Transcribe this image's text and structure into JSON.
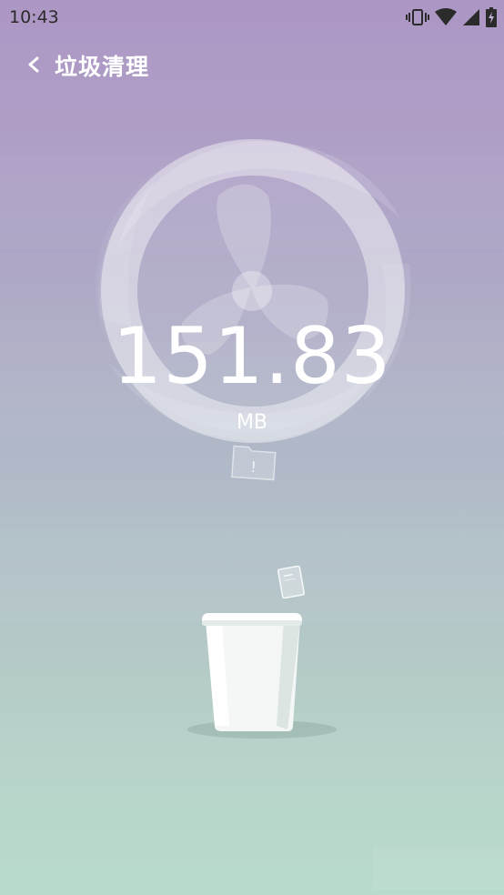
{
  "status_bar": {
    "time": "10:43",
    "icons": [
      "vibrate-icon",
      "wifi-icon",
      "signal-icon",
      "battery-icon"
    ]
  },
  "header": {
    "back_icon": "chevron-left-icon",
    "title": "垃圾清理"
  },
  "scan": {
    "size_value": "151.83",
    "size_unit": "MB"
  },
  "decor": {
    "fan_icon": "fan-icon",
    "folder_icon": "folder-warning-icon",
    "folder_mark": "!",
    "file_icon": "file-icon",
    "trash_icon": "trash-can-icon"
  },
  "colors": {
    "gradient_top": "#ad97c5",
    "gradient_mid": "#b0b8c8",
    "gradient_bottom": "#b8dccb",
    "text": "#ffffff"
  }
}
